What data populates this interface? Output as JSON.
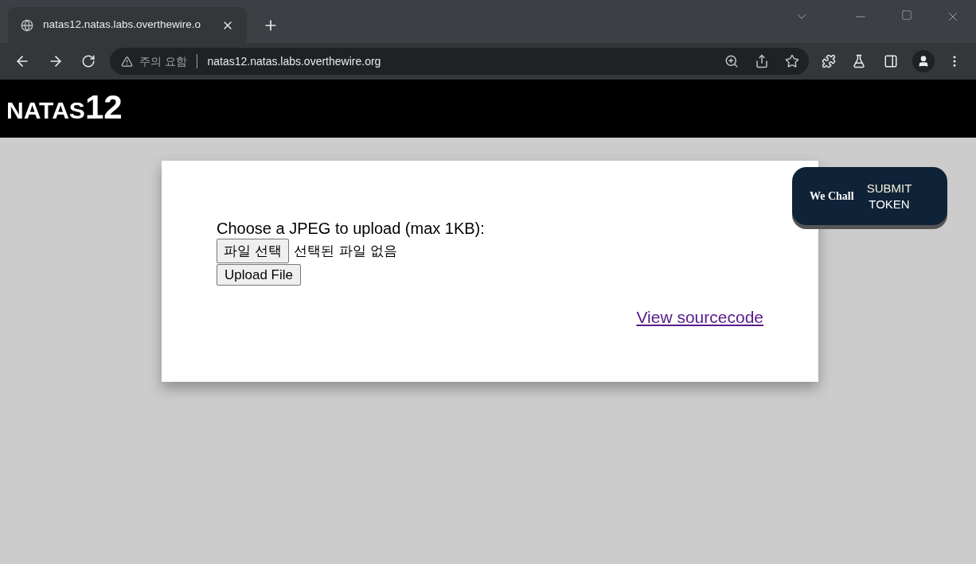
{
  "browser": {
    "tab": {
      "title": "natas12.natas.labs.overthewire.o"
    },
    "security_label": "주의 요함",
    "url": "natas12.natas.labs.overthewire.org"
  },
  "header": {
    "title": "NATAS",
    "number": "12"
  },
  "form": {
    "prompt": "Choose a JPEG to upload (max 1KB):",
    "file_button": "파일 선택",
    "file_status": "선택된 파일 없음",
    "upload_button": "Upload File",
    "link": "View sourcecode"
  },
  "wechall": {
    "logo_text": "We Chall",
    "line_1": "SUBMIT",
    "line_2": "TOKEN"
  }
}
